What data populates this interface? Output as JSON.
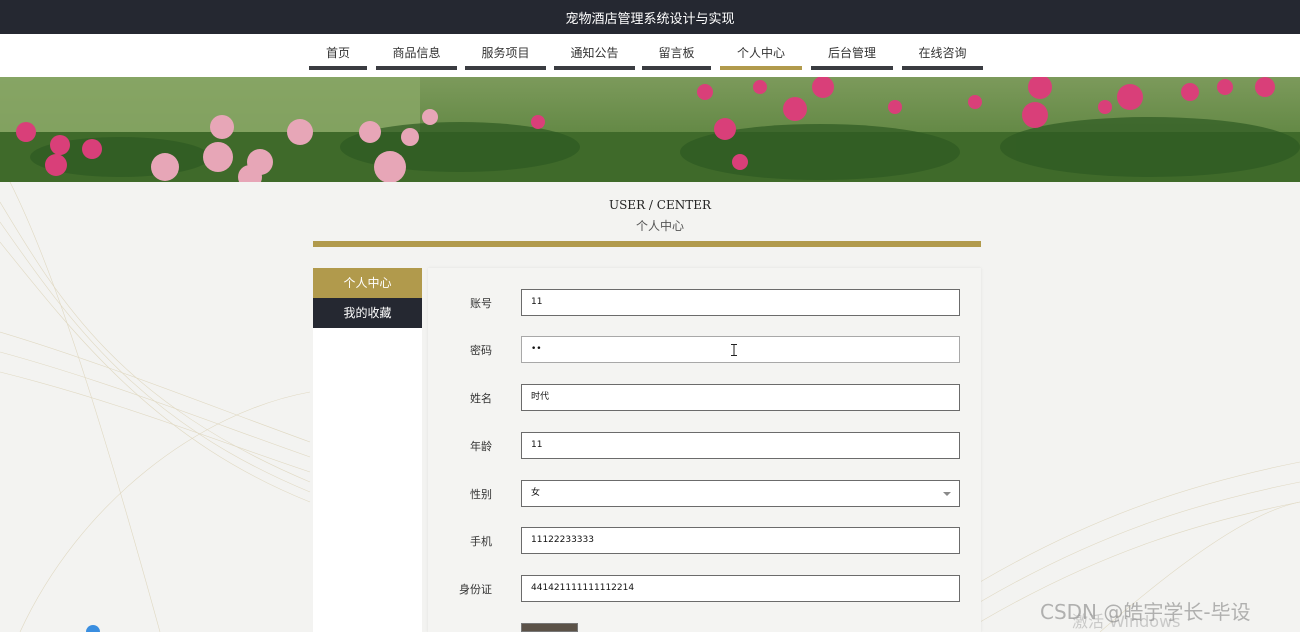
{
  "app": {
    "title": "宠物酒店管理系统设计与实现"
  },
  "nav": {
    "items": [
      {
        "label": "首页"
      },
      {
        "label": "商品信息"
      },
      {
        "label": "服务项目"
      },
      {
        "label": "通知公告"
      },
      {
        "label": "留言板"
      },
      {
        "label": "个人中心"
      },
      {
        "label": "后台管理"
      },
      {
        "label": "在线咨询"
      }
    ],
    "active_label": "个人中心"
  },
  "section": {
    "title_en": "USER / CENTER",
    "title_cn": "个人中心"
  },
  "sidebar": {
    "items": [
      {
        "label": "个人中心"
      },
      {
        "label": "我的收藏"
      }
    ]
  },
  "form": {
    "fields": [
      {
        "label": "账号",
        "value": "11"
      },
      {
        "label": "密码",
        "value": "••"
      },
      {
        "label": "姓名",
        "value": "时代"
      },
      {
        "label": "年龄",
        "value": "11"
      },
      {
        "label": "性别",
        "value": "女"
      },
      {
        "label": "手机",
        "value": "11122233333"
      },
      {
        "label": "身份证",
        "value": "441421111111112214"
      }
    ]
  },
  "overlay": {
    "watermark": "CSDN @皓宇学长-毕设",
    "activate": "激活 Windows"
  },
  "colors": {
    "accent": "#b19a4c",
    "dark": "#252831",
    "nav_bar": "#3a3c41"
  }
}
